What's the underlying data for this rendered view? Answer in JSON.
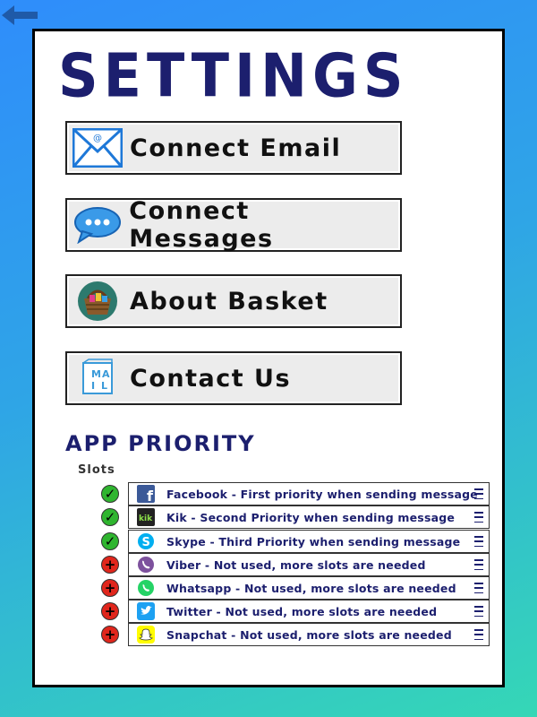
{
  "header": {
    "title": "SETTINGS",
    "back_icon": "back-arrow-icon"
  },
  "menu": [
    {
      "label": "Connect Email",
      "icon": "email-envelope-icon"
    },
    {
      "label": "Connect Messages",
      "icon": "chat-bubble-icon"
    },
    {
      "label": "About Basket",
      "icon": "basket-icon"
    },
    {
      "label": "Contact Us",
      "icon": "mail-letter-icon"
    }
  ],
  "priority": {
    "title": "APP PRIORITY",
    "slots_label": "Slots",
    "rows": [
      {
        "app": "Facebook",
        "text": "Facebook - First priority when sending message",
        "status": "active",
        "icon": "facebook-icon"
      },
      {
        "app": "Kik",
        "text": "Kik - Second Priority when sending message",
        "status": "active",
        "icon": "kik-icon"
      },
      {
        "app": "Skype",
        "text": "Skype - Third Priority when sending message",
        "status": "active",
        "icon": "skype-icon"
      },
      {
        "app": "Viber",
        "text": "Viber - Not used, more slots are needed",
        "status": "unused",
        "icon": "viber-icon"
      },
      {
        "app": "Whatsapp",
        "text": "Whatsapp - Not used, more slots are needed",
        "status": "unused",
        "icon": "whatsapp-icon"
      },
      {
        "app": "Twitter",
        "text": "Twitter - Not used, more slots are needed",
        "status": "unused",
        "icon": "twitter-icon"
      },
      {
        "app": "Snapchat",
        "text": "Snapchat - Not used, more slots are needed",
        "status": "unused",
        "icon": "snapchat-icon"
      }
    ]
  },
  "colors": {
    "accent_navy": "#1c1f6e",
    "active": "#2fb52f",
    "unused": "#e0261c"
  }
}
